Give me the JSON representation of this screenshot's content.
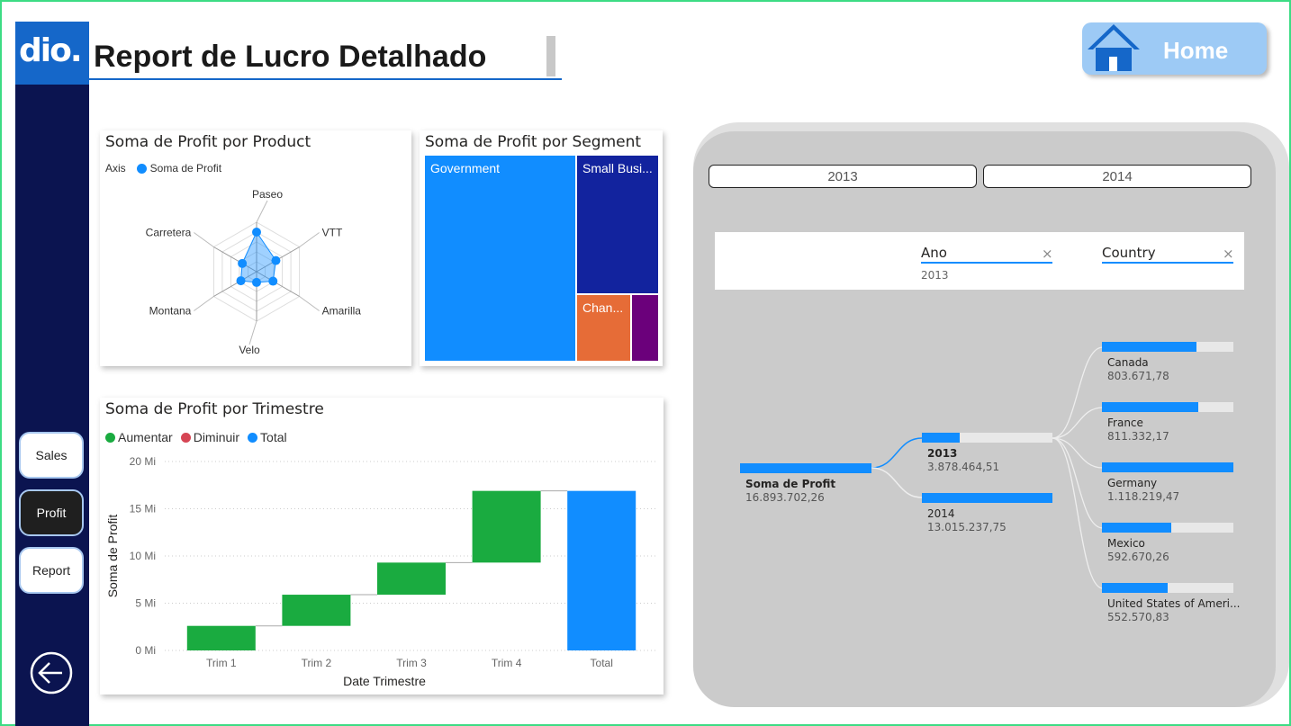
{
  "header": {
    "logo_text": "dio.",
    "title": "Report de Lucro Detalhado",
    "home_label": "Home"
  },
  "nav": {
    "items": [
      {
        "label": "Sales",
        "active": false
      },
      {
        "label": "Profit",
        "active": true
      },
      {
        "label": "Report",
        "active": false
      }
    ]
  },
  "radar": {
    "title": "Soma de Profit por Product",
    "legend_axis": "Axis",
    "legend_series": "Soma de Profit",
    "color": "#118dff"
  },
  "treemap": {
    "title": "Soma de Profit por Segment",
    "tiles": [
      {
        "label": "Government",
        "color": "#118dff"
      },
      {
        "label": "Small Busi...",
        "color": "#12239e"
      },
      {
        "label": "Chan...",
        "color": "#e66c37"
      },
      {
        "label": "",
        "color": "#6b007b"
      }
    ]
  },
  "waterfall": {
    "title": "Soma de Profit por Trimestre",
    "legend": [
      {
        "label": "Aumentar",
        "color": "#1aab40"
      },
      {
        "label": "Diminuir",
        "color": "#d64554"
      },
      {
        "label": "Total",
        "color": "#118dff"
      }
    ]
  },
  "chart_data": [
    {
      "type": "radar",
      "title": "Soma de Profit por Product",
      "categories": [
        "Paseo",
        "VTT",
        "Amarilla",
        "Velo",
        "Montana",
        "Carretera"
      ],
      "series": [
        {
          "name": "Soma de Profit",
          "values": [
            4.8,
            2.7,
            2.3,
            1.3,
            2.2,
            2.0
          ]
        }
      ],
      "legend": "top-left"
    },
    {
      "type": "bar",
      "title": "Soma de Profit por Trimestre",
      "xlabel": "Date Trimestre",
      "ylabel": "Soma de Profit",
      "categories": [
        "Trim 1",
        "Trim 2",
        "Trim 3",
        "Trim 4",
        "Total"
      ],
      "start": [
        0,
        2.6,
        5.9,
        9.3,
        0
      ],
      "end": [
        2.6,
        5.9,
        9.3,
        16.89,
        16.89
      ],
      "kind": [
        "increase",
        "increase",
        "increase",
        "increase",
        "total"
      ],
      "yticks": [
        "0 Mi",
        "5 Mi",
        "10 Mi",
        "15 Mi",
        "20 Mi"
      ],
      "ylim": [
        0,
        20
      ],
      "grid": true,
      "legend": "top-left"
    }
  ],
  "slicer": {
    "options": [
      "2013",
      "2014"
    ]
  },
  "filters": [
    {
      "label": "Ano",
      "value": "2013",
      "clear": "×"
    },
    {
      "label": "Country",
      "value": "",
      "clear": "×"
    }
  ],
  "decomposition": {
    "root": {
      "label": "Soma de Profit",
      "value": "16.893.702,26",
      "fill": 1.0
    },
    "years": [
      {
        "label": "2013",
        "value": "3.878.464,51",
        "fill": 0.29,
        "selected": true
      },
      {
        "label": "2014",
        "value": "13.015.237,75",
        "fill": 1.0,
        "selected": false
      }
    ],
    "countries": [
      {
        "label": "Canada",
        "value": "803.671,78",
        "fill": 0.72
      },
      {
        "label": "France",
        "value": "811.332,17",
        "fill": 0.73
      },
      {
        "label": "Germany",
        "value": "1.118.219,47",
        "fill": 1.0
      },
      {
        "label": "Mexico",
        "value": "592.670,26",
        "fill": 0.53
      },
      {
        "label": "United States of Ameri...",
        "value": "552.570,83",
        "fill": 0.5
      }
    ]
  }
}
